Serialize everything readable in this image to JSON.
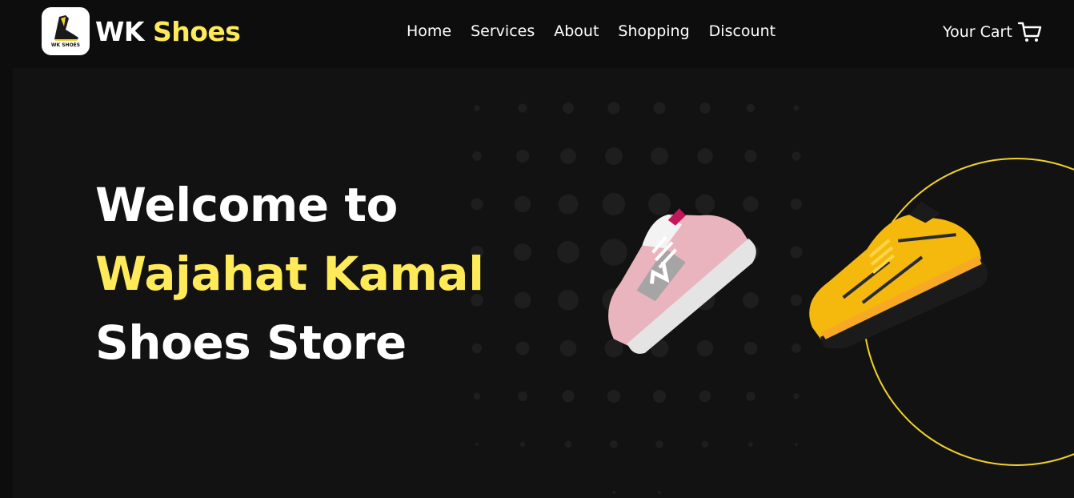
{
  "header": {
    "logo_caption": "WK SHOES",
    "brand_first": "WK",
    "brand_second": "Shoes",
    "nav": [
      "Home",
      "Services",
      "About",
      "Shopping",
      "Discount"
    ],
    "cart_label": "Your Cart",
    "cart_icon": "shopping-cart-icon"
  },
  "hero": {
    "line1": "Welcome to",
    "line2": "Wajahat Kamal",
    "line3": "Shoes Store",
    "left_shoe": "pink-sneaker",
    "right_shoe": "yellow-sneaker"
  },
  "colors": {
    "accent": "#ffeb5a",
    "background": "#0d0d0d",
    "hero_background": "#121212",
    "ring": "#f2d22a"
  }
}
